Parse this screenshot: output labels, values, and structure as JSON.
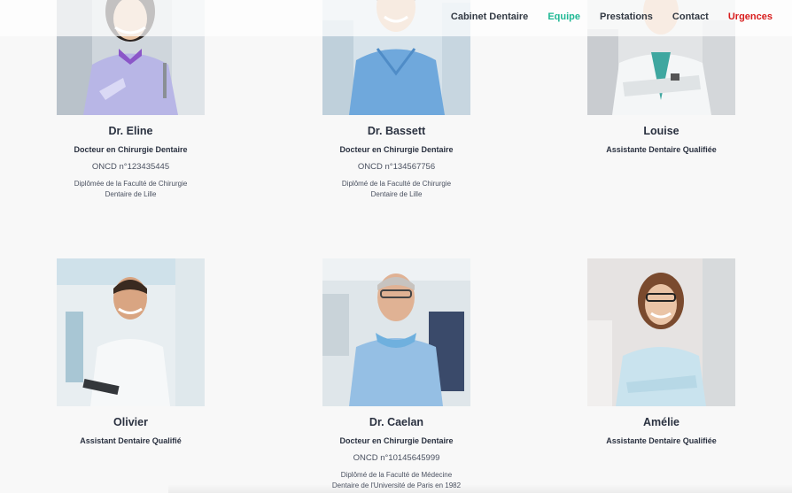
{
  "nav": {
    "items": [
      {
        "label": "Cabinet Dentaire",
        "state": "normal"
      },
      {
        "label": "Equipe",
        "state": "active"
      },
      {
        "label": "Prestations",
        "state": "normal"
      },
      {
        "label": "Contact",
        "state": "normal"
      },
      {
        "label": "Urgences",
        "state": "urgent"
      }
    ],
    "active_color": "#1fb894",
    "urgent_color": "#d81c1c"
  },
  "team": [
    {
      "name": "Dr. Eline",
      "role": "Docteur en Chirurgie Dentaire",
      "oncd": "ONCD n°123435445",
      "diploma_line1": "Diplômée de la Faculté de Chirurgie",
      "diploma_line2": "Dentaire de Lille"
    },
    {
      "name": "Dr. Bassett",
      "role": "Docteur en Chirurgie Dentaire",
      "oncd": "ONCD n°134567756",
      "diploma_line1": "Diplômé de la Faculté de Chirurgie",
      "diploma_line2": "Dentaire de Lille"
    },
    {
      "name": "Louise",
      "role": "Assistante Dentaire Qualifiée"
    },
    {
      "name": "Olivier",
      "role": "Assistant Dentaire Qualifié"
    },
    {
      "name": "Dr. Caelan",
      "role": "Docteur en Chirurgie Dentaire",
      "oncd": "ONCD n°10145645999",
      "diploma_line1": "Diplômé de la Faculté de Médecine",
      "diploma_line2": "Dentaire de l'Université de Paris en 1982"
    },
    {
      "name": "Amélie",
      "role": "Assistante Dentaire Qualifiée"
    }
  ]
}
